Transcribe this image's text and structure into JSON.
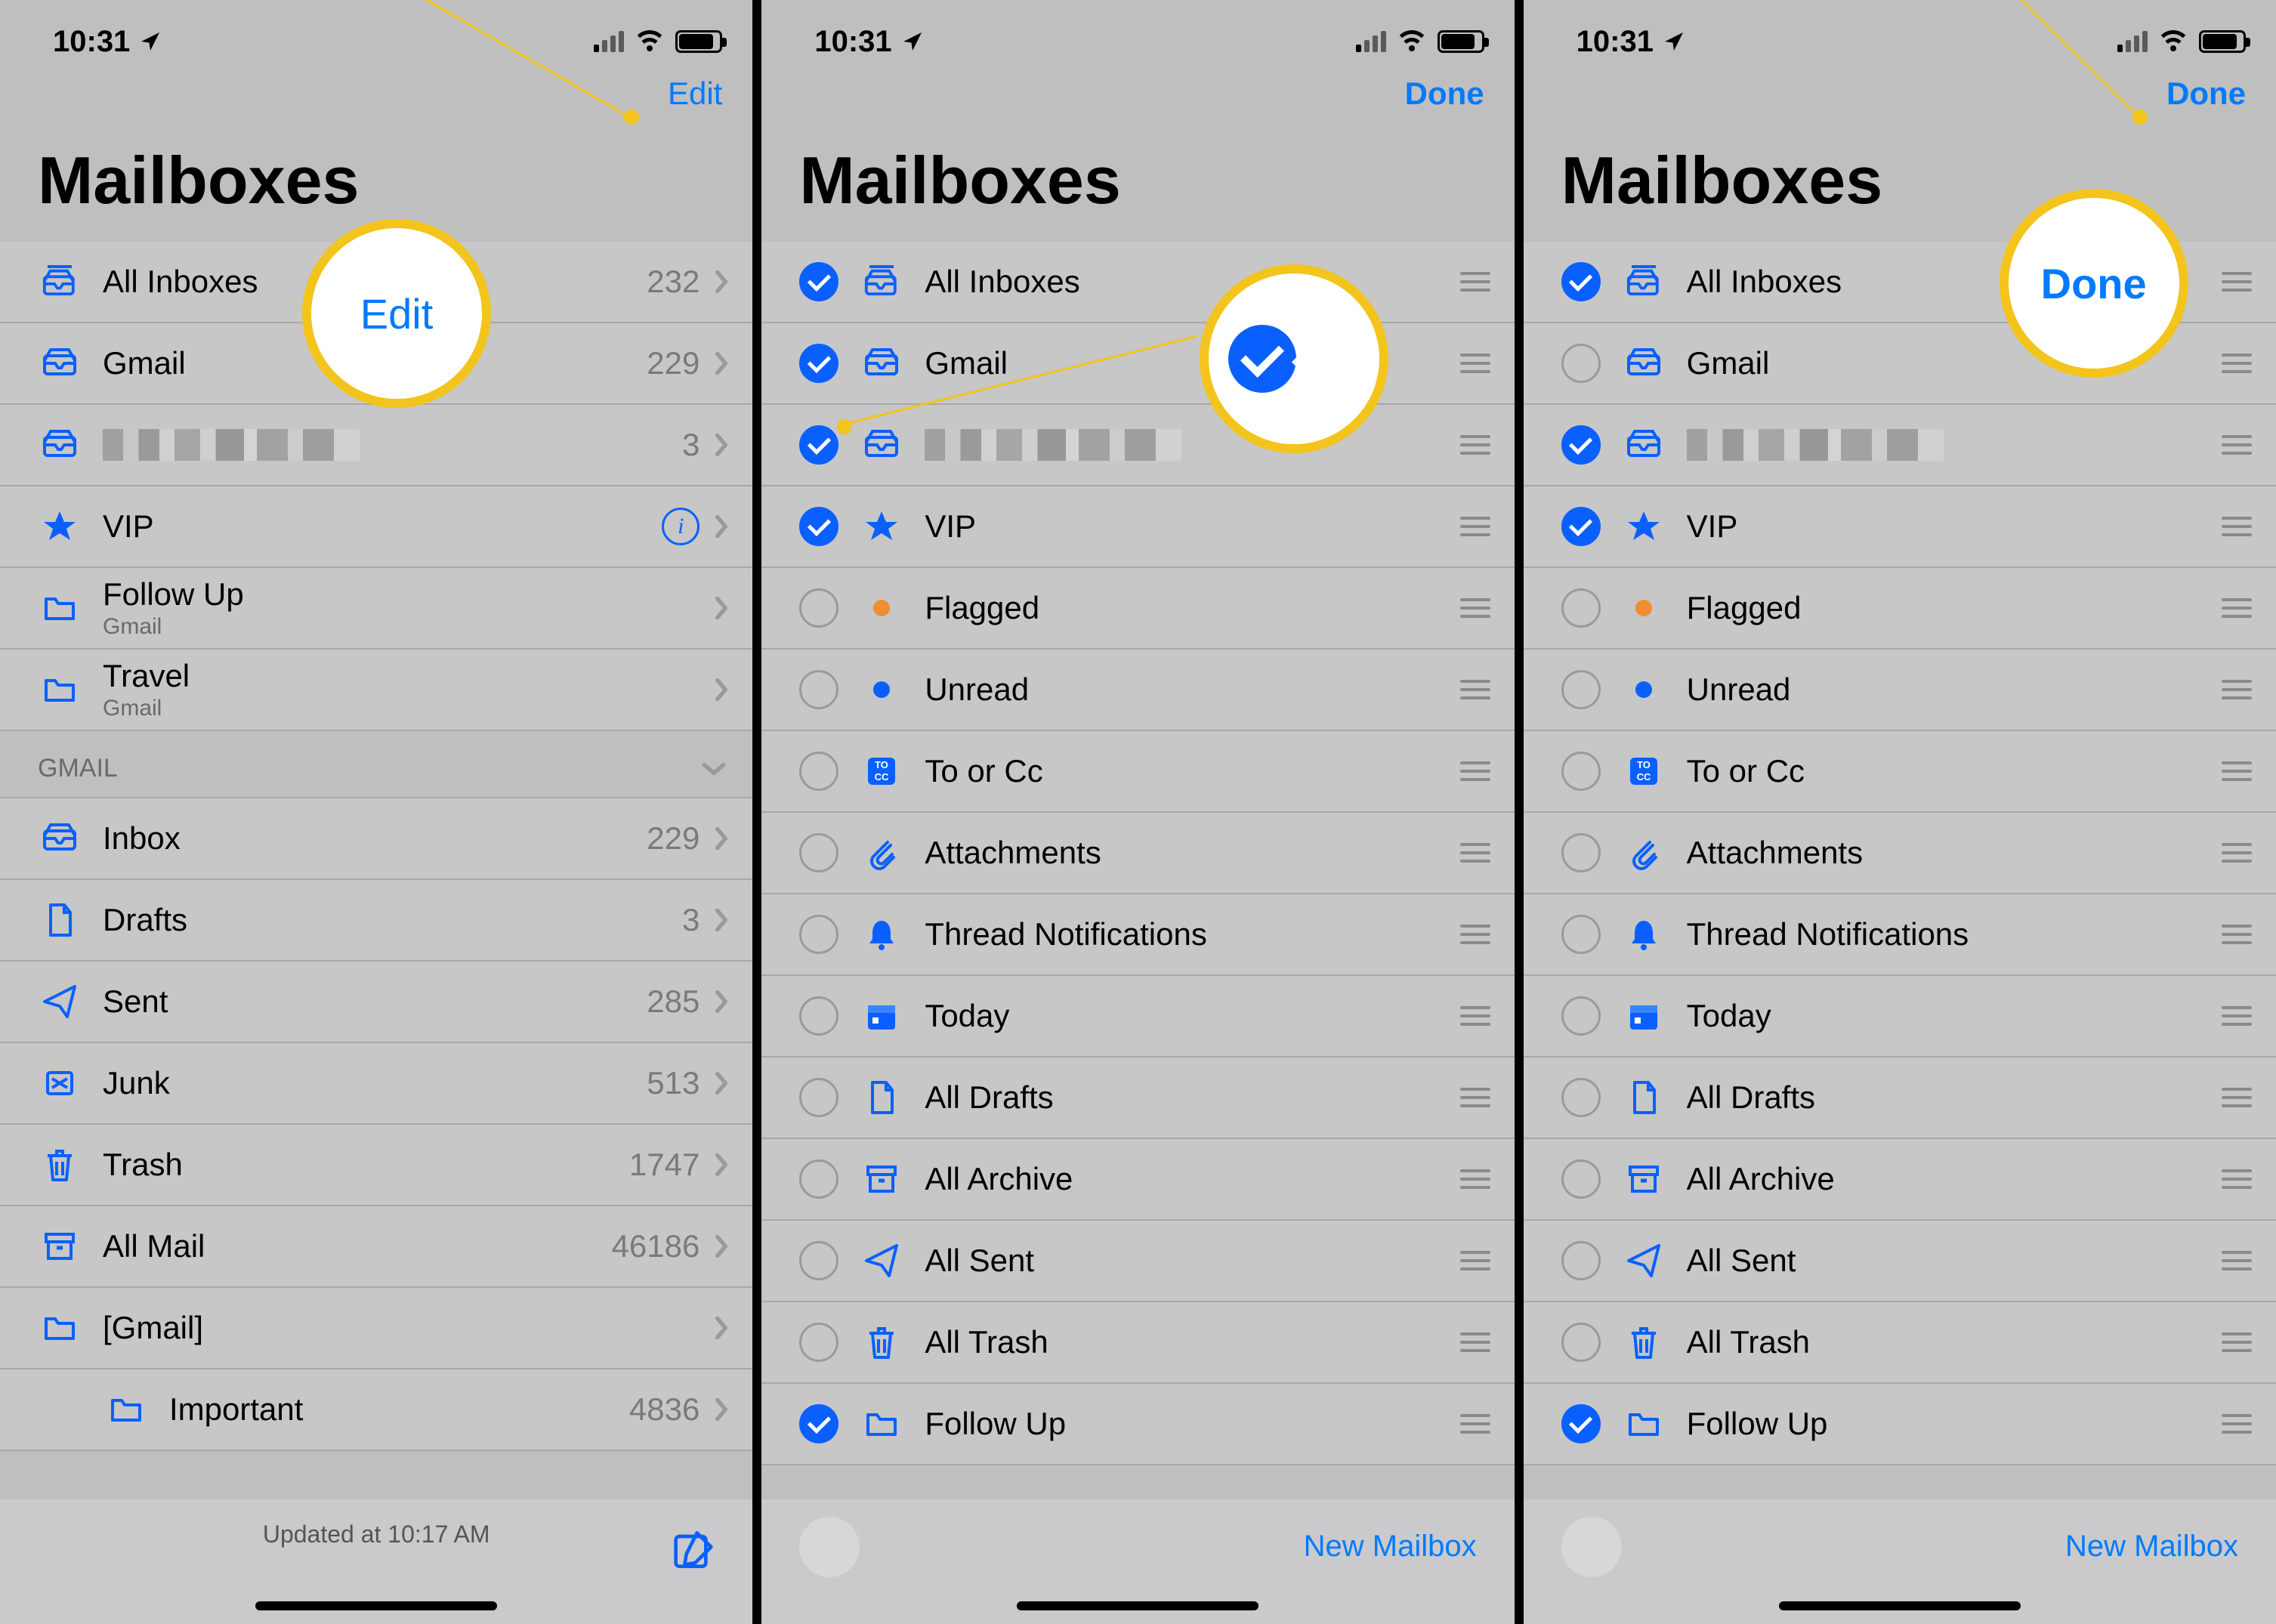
{
  "status": {
    "time": "10:31"
  },
  "panelA": {
    "nav_button": "Edit",
    "title": "Mailboxes",
    "callout_label": "Edit",
    "section_header": "GMAIL",
    "mailboxes": [
      {
        "icon": "inbox-stack",
        "label": "All Inboxes",
        "count": "232"
      },
      {
        "icon": "inbox",
        "label": "Gmail",
        "count": "229"
      },
      {
        "icon": "inbox",
        "label": "",
        "count": "3",
        "redacted": true
      },
      {
        "icon": "star",
        "label": "VIP",
        "info": true
      },
      {
        "icon": "folder",
        "label": "Follow Up",
        "sub": "Gmail"
      },
      {
        "icon": "folder",
        "label": "Travel",
        "sub": "Gmail"
      }
    ],
    "gmail_folders": [
      {
        "icon": "inbox",
        "label": "Inbox",
        "count": "229"
      },
      {
        "icon": "draft",
        "label": "Drafts",
        "count": "3"
      },
      {
        "icon": "sent",
        "label": "Sent",
        "count": "285"
      },
      {
        "icon": "junk",
        "label": "Junk",
        "count": "513"
      },
      {
        "icon": "trash",
        "label": "Trash",
        "count": "1747"
      },
      {
        "icon": "archive",
        "label": "All Mail",
        "count": "46186"
      },
      {
        "icon": "folder",
        "label": "[Gmail]",
        "count": ""
      },
      {
        "icon": "folder",
        "label": "Important",
        "count": "4836",
        "indent": true
      }
    ],
    "toolbar_status": "Updated at 10:17 AM"
  },
  "panelB": {
    "nav_button": "Done",
    "title": "Mailboxes",
    "items": [
      {
        "checked": true,
        "icon": "inbox-stack",
        "label": "All Inboxes"
      },
      {
        "checked": true,
        "icon": "inbox",
        "label": "Gmail"
      },
      {
        "checked": true,
        "icon": "inbox",
        "label": "",
        "redacted": true
      },
      {
        "checked": true,
        "icon": "star",
        "label": "VIP"
      },
      {
        "checked": false,
        "icon": "orange-dot",
        "label": "Flagged"
      },
      {
        "checked": false,
        "icon": "blue-dot",
        "label": "Unread"
      },
      {
        "checked": false,
        "icon": "tocc",
        "label": "To or Cc"
      },
      {
        "checked": false,
        "icon": "paperclip",
        "label": "Attachments"
      },
      {
        "checked": false,
        "icon": "bell",
        "label": "Thread Notifications"
      },
      {
        "checked": false,
        "icon": "calendar",
        "label": "Today"
      },
      {
        "checked": false,
        "icon": "draft",
        "label": "All Drafts"
      },
      {
        "checked": false,
        "icon": "archive",
        "label": "All Archive"
      },
      {
        "checked": false,
        "icon": "sent",
        "label": "All Sent"
      },
      {
        "checked": false,
        "icon": "trash",
        "label": "All Trash"
      },
      {
        "checked": true,
        "icon": "folder",
        "label": "Follow Up"
      }
    ],
    "toolbar_button": "New Mailbox"
  },
  "panelC": {
    "nav_button": "Done",
    "title": "Mailboxes",
    "callout_label": "Done",
    "items": [
      {
        "checked": true,
        "icon": "inbox-stack",
        "label": "All Inboxes"
      },
      {
        "checked": false,
        "icon": "inbox",
        "label": "Gmail"
      },
      {
        "checked": true,
        "icon": "inbox",
        "label": "",
        "redacted": true
      },
      {
        "checked": true,
        "icon": "star",
        "label": "VIP"
      },
      {
        "checked": false,
        "icon": "orange-dot",
        "label": "Flagged"
      },
      {
        "checked": false,
        "icon": "blue-dot",
        "label": "Unread"
      },
      {
        "checked": false,
        "icon": "tocc",
        "label": "To or Cc"
      },
      {
        "checked": false,
        "icon": "paperclip",
        "label": "Attachments"
      },
      {
        "checked": false,
        "icon": "bell",
        "label": "Thread Notifications"
      },
      {
        "checked": false,
        "icon": "calendar",
        "label": "Today"
      },
      {
        "checked": false,
        "icon": "draft",
        "label": "All Drafts"
      },
      {
        "checked": false,
        "icon": "archive",
        "label": "All Archive"
      },
      {
        "checked": false,
        "icon": "sent",
        "label": "All Sent"
      },
      {
        "checked": false,
        "icon": "trash",
        "label": "All Trash"
      },
      {
        "checked": true,
        "icon": "folder",
        "label": "Follow Up"
      }
    ],
    "toolbar_button": "New Mailbox"
  }
}
